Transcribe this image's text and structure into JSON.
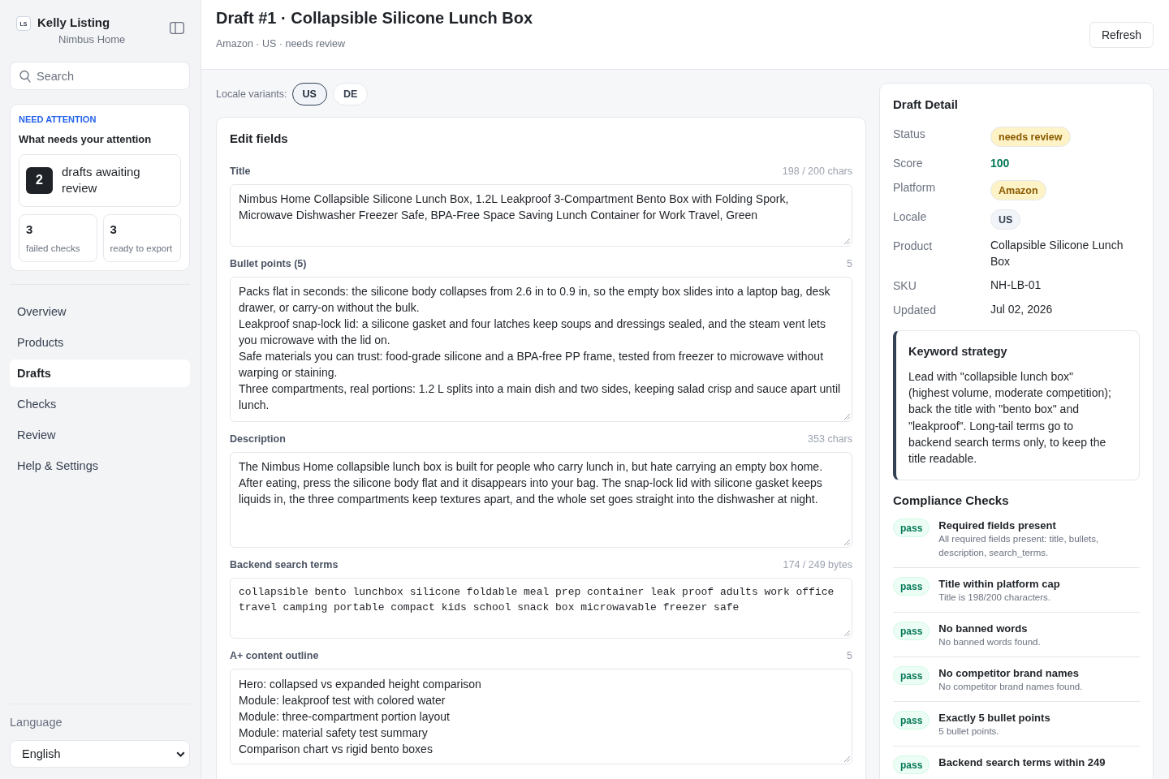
{
  "sidebar": {
    "brand": {
      "logo": "LS",
      "name": "Kelly Listing",
      "subtitle": "Nimbus Home"
    },
    "search": {
      "placeholder": "Search"
    },
    "attention": {
      "eyebrow": "NEED ATTENTION",
      "title": "What needs your attention",
      "primary": {
        "count": "2",
        "label": "drafts awaiting review"
      },
      "stats": [
        {
          "count": "3",
          "label": "failed checks"
        },
        {
          "count": "3",
          "label": "ready to export"
        }
      ]
    },
    "nav": [
      {
        "label": "Overview",
        "selected": false
      },
      {
        "label": "Products",
        "selected": false
      },
      {
        "label": "Drafts",
        "selected": true
      },
      {
        "label": "Checks",
        "selected": false
      },
      {
        "label": "Review",
        "selected": false
      },
      {
        "label": "Help & Settings",
        "selected": false
      }
    ],
    "language": {
      "label": "Language",
      "value": "English"
    }
  },
  "header": {
    "title": "Draft #1 · Collapsible Silicone Lunch Box",
    "subtitle": "Amazon · US · needs review",
    "refresh_button": "Refresh"
  },
  "locale_variants": {
    "label": "Locale variants:",
    "options": [
      {
        "label": "US",
        "selected": true
      },
      {
        "label": "DE",
        "selected": false
      }
    ]
  },
  "edit_fields": {
    "title": "Edit fields",
    "fields": [
      {
        "kind": "title",
        "label": "Title",
        "counter": "198 / 200 chars",
        "value": "Nimbus Home Collapsible Silicone Lunch Box, 1.2L Leakproof 3-Compartment Bento Box with Folding Spork, Microwave Dishwasher Freezer Safe, BPA-Free Space Saving Lunch Container for Work Travel, Green"
      },
      {
        "kind": "bullets",
        "label": "Bullet points (5)",
        "counter": "5",
        "lines": [
          "Packs flat in seconds: the silicone body collapses from 2.6 in to 0.9 in, so the empty box slides into a laptop bag, desk drawer, or carry-on without the bulk.",
          "Leakproof snap-lock lid: a silicone gasket and four latches keep soups and dressings sealed, and the steam vent lets you microwave with the lid on.",
          "Safe materials you can trust: food-grade silicone and a BPA-free PP frame, tested from freezer to microwave without warping or staining.",
          "Three compartments, real portions: 1.2 L splits into a main dish and two sides, keeping salad crisp and sauce apart until lunch."
        ]
      },
      {
        "kind": "description",
        "label": "Description",
        "counter": "353 chars",
        "value": "The Nimbus Home collapsible lunch box is built for people who carry lunch in, but hate carrying an empty box home. After eating, press the silicone body flat and it disappears into your bag. The snap-lock lid with silicone gasket keeps liquids in, the three compartments keep textures apart, and the whole set goes straight into the dishwasher at night."
      },
      {
        "kind": "search_terms",
        "label": "Backend search terms",
        "counter": "174 / 249 bytes",
        "value": "collapsible bento lunchbox silicone foldable meal prep container leak proof adults work office travel camping portable compact kids school snack box microwavable freezer safe"
      },
      {
        "kind": "outline",
        "label": "A+ content outline",
        "counter": "5",
        "lines": [
          "Hero: collapsed vs expanded height comparison",
          "Module: leakproof test with colored water",
          "Module: three-compartment portion layout",
          "Module: material safety test summary",
          "Comparison chart vs rigid bento boxes"
        ]
      }
    ]
  },
  "draft_detail": {
    "title": "Draft Detail",
    "rows": [
      {
        "kind": "pill",
        "color": "#fef3c7",
        "label": "Status",
        "value": "needs review"
      },
      {
        "kind": "score",
        "label": "Score",
        "value": "100"
      },
      {
        "kind": "pill",
        "color": "#fef3c7",
        "label": "Platform",
        "value": "Amazon"
      },
      {
        "kind": "pill",
        "color": "#f1f5f9",
        "label": "Locale",
        "value": "US"
      },
      {
        "kind": "text",
        "label": "Product",
        "value": "Collapsible Silicone Lunch Box"
      },
      {
        "kind": "text",
        "label": "SKU",
        "value": "NH-LB-01"
      },
      {
        "kind": "text",
        "label": "Updated",
        "value": "Jul 02, 2026"
      }
    ],
    "keyword_strategy": {
      "title": "Keyword strategy",
      "body": "Lead with \"collapsible lunch box\" (highest volume, moderate competition); back the title with \"bento box\" and \"leakproof\". Long-tail terms go to backend search terms only, to keep the title readable."
    },
    "compliance": {
      "title": "Compliance Checks",
      "checks": [
        {
          "badge": "pass",
          "passed": true,
          "title": "Required fields present",
          "detail": "All required fields present: title, bullets, description, search_terms."
        },
        {
          "badge": "pass",
          "passed": true,
          "title": "Title within platform cap",
          "detail": "Title is 198/200 characters."
        },
        {
          "badge": "pass",
          "passed": true,
          "title": "No banned words",
          "detail": "No banned words found."
        },
        {
          "badge": "pass",
          "passed": true,
          "title": "No competitor brand names",
          "detail": "No competitor brand names found."
        },
        {
          "badge": "pass",
          "passed": true,
          "title": "Exactly 5 bullet points",
          "detail": "5 bullet points."
        },
        {
          "badge": "pass",
          "passed": true,
          "title": "Backend search terms within 249"
        }
      ]
    }
  }
}
